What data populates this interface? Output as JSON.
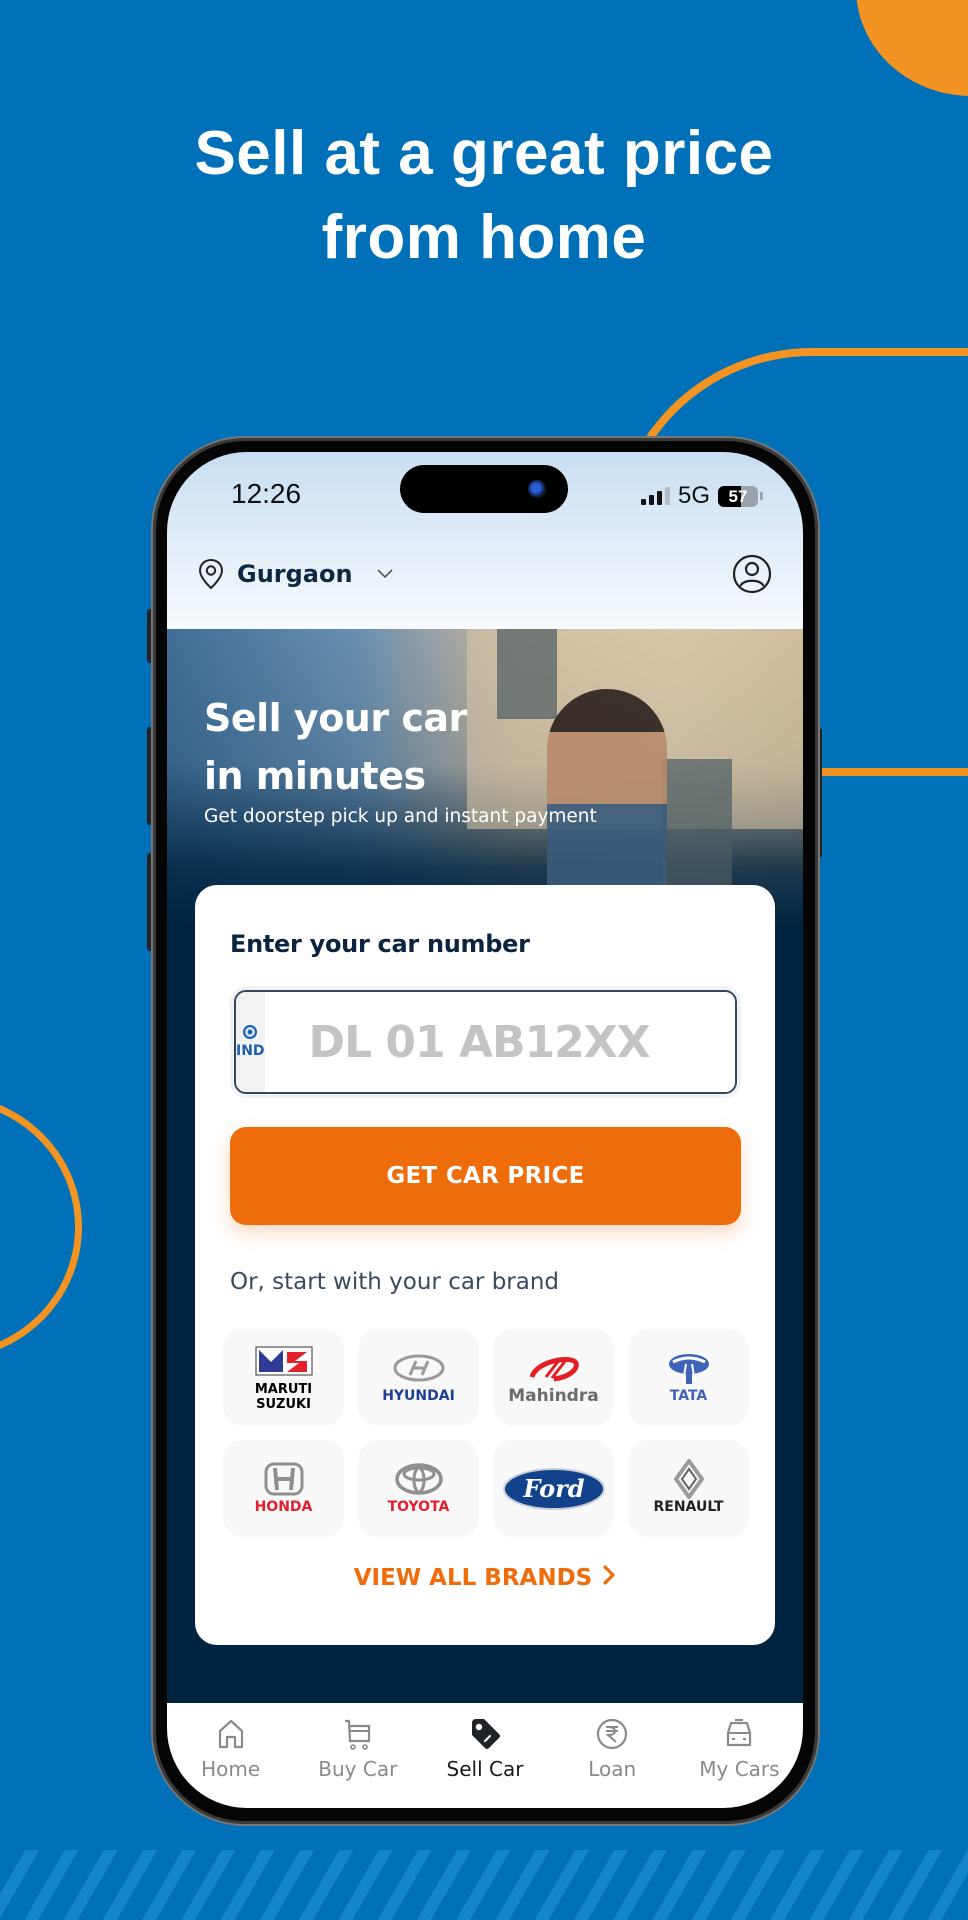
{
  "headline": {
    "line1": "Sell at a great price",
    "line2": "from home"
  },
  "status_bar": {
    "time": "12:26",
    "network": "5G",
    "battery_level": 57,
    "battery_text": "57",
    "signal_bars_active": 3,
    "signal_bars_total": 4
  },
  "header": {
    "location": "Gurgaon",
    "location_icon": "map-pin-icon",
    "dropdown_icon": "chevron-down-icon",
    "profile_icon": "user-circle-icon"
  },
  "banner": {
    "title_line1": "Sell your car",
    "title_line2": "in minutes",
    "subtitle": "Get doorstep pick up and instant payment"
  },
  "car_number": {
    "heading": "Enter your car number",
    "country_label": "IND",
    "placeholder": "DL 01 AB12XX",
    "value": ""
  },
  "cta": {
    "label": "GET CAR PRICE"
  },
  "brands": {
    "prompt": "Or, start with your car brand",
    "items": [
      {
        "name": "Maruti Suzuki",
        "word": "MARUTI SUZUKI",
        "color": "#000000",
        "accent": "#E4202B"
      },
      {
        "name": "Hyundai",
        "word": "HYUNDAI",
        "color": "#1C3E94",
        "accent": "#9A9A9A"
      },
      {
        "name": "Mahindra",
        "word": "Mahindra",
        "color": "#6B6B6B",
        "accent": "#E31E24"
      },
      {
        "name": "Tata",
        "word": "TATA",
        "color": "#3F63B8",
        "accent": "#3F63B8"
      },
      {
        "name": "Honda",
        "word": "HONDA",
        "color": "#E31E2D",
        "accent": "#8F8F8F"
      },
      {
        "name": "Toyota",
        "word": "TOYOTA",
        "color": "#E31E2D",
        "accent": "#8F8F8F"
      },
      {
        "name": "Ford",
        "word": "Ford",
        "color": "#FFFFFF",
        "accent": "#13428C"
      },
      {
        "name": "Renault",
        "word": "RENAULT",
        "color": "#222222",
        "accent": "#9A9A9A"
      }
    ],
    "view_all": "VIEW ALL BRANDS"
  },
  "bottom_nav": {
    "items": [
      {
        "label": "Home",
        "icon": "home-icon",
        "active": false
      },
      {
        "label": "Buy Car",
        "icon": "cart-icon",
        "active": false
      },
      {
        "label": "Sell Car",
        "icon": "price-tag-icon",
        "active": true
      },
      {
        "label": "Loan",
        "icon": "rupee-icon",
        "active": false
      },
      {
        "label": "My Cars",
        "icon": "car-icon",
        "active": false
      }
    ]
  },
  "colors": {
    "background": "#0070B8",
    "accent_orange": "#EF6C0A",
    "decor_orange": "#F39322",
    "navy": "#00233F",
    "heading_navy": "#0B2440"
  }
}
